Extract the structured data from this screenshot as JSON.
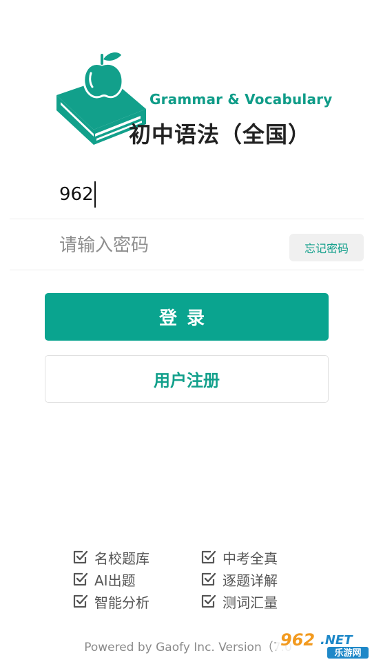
{
  "logo": {
    "title_en": "Grammar & Vocabulary",
    "title_zh": "初中语法（全国）",
    "brand_color": "#12a08b"
  },
  "login_form": {
    "username_value": "962",
    "password_placeholder": "请输入密码",
    "forgot_password_label": "忘记密码"
  },
  "actions": {
    "login_label": "登录",
    "register_label": "用户注册",
    "login_color": "#0aa48f"
  },
  "features": [
    {
      "label": "名校题库",
      "icon": "check-square-icon"
    },
    {
      "label": "中考全真",
      "icon": "check-square-icon"
    },
    {
      "label": "AI出题",
      "icon": "check-square-icon"
    },
    {
      "label": "逐题详解",
      "icon": "check-square-icon"
    },
    {
      "label": "智能分析",
      "icon": "check-square-icon"
    },
    {
      "label": "测词汇量",
      "icon": "check-square-icon"
    }
  ],
  "footer": {
    "text": "Powered by Gaofy Inc. Version（7.0"
  },
  "watermark": {
    "number": "962",
    "suffix": ".NET",
    "subtitle": "乐游网"
  }
}
